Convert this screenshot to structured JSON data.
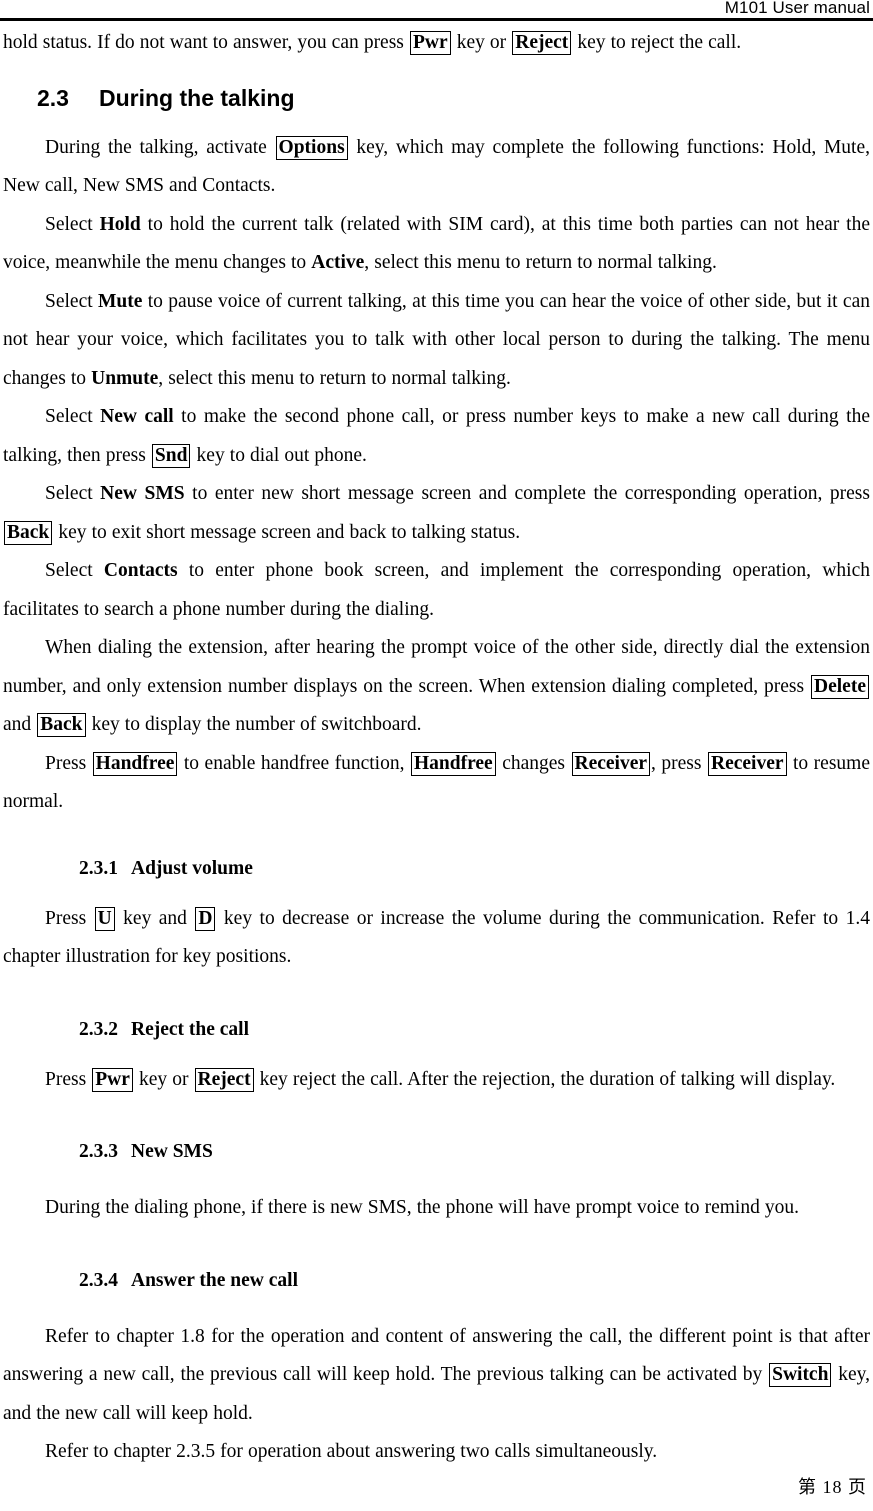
{
  "header": {
    "title": "M101 User manual"
  },
  "footer": {
    "page_label_prefix": "第",
    "page_number": "18",
    "page_label_suffix": "页",
    "full": "第  18  页"
  },
  "content": {
    "carryover_paragraph": {
      "before": "hold status. If do not want to answer, you can press ",
      "key1": "Pwr",
      "mid1": " key or ",
      "key2": "Reject",
      "after": " key to reject the call."
    },
    "section": {
      "number": "2.3",
      "title": "During the talking"
    },
    "p_options": {
      "before": "During the talking, activate ",
      "key1": "Options",
      "after": " key, which may complete the following functions: Hold, Mute, New call, New SMS and Contacts."
    },
    "p_hold": {
      "before": "Select ",
      "bold1": "Hold",
      "mid1": " to hold the current talk (related with SIM card), at this time both parties can not hear the voice, meanwhile the menu changes to ",
      "bold2": "Active",
      "after": ", select this menu to return to normal talking."
    },
    "p_mute": {
      "before": "Select ",
      "bold1": "Mute",
      "mid1": " to pause voice of current talking, at this time you can hear the voice of other side, but it can not hear your voice, which facilitates you to talk with other local person to during the talking. The menu changes to ",
      "bold2": "Unmute",
      "after": ", select this menu to return to normal talking."
    },
    "p_newcall": {
      "before": "Select ",
      "bold1": "New call",
      "mid1": " to make the second phone call, or press number keys to make a new call during the talking, then press ",
      "key1": "Snd",
      "after": " key to dial out phone."
    },
    "p_newsms": {
      "before": "Select ",
      "bold1": "New SMS",
      "mid1": " to enter new short message screen and complete the corresponding operation, press ",
      "key1": "Back",
      "after": " key to exit short message screen and back to talking status."
    },
    "p_contacts": {
      "before": "Select ",
      "bold1": "Contacts",
      "after": " to enter phone book screen, and implement the corresponding operation, which facilitates to search a phone number during the dialing."
    },
    "p_extension": {
      "before": "When dialing the extension, after hearing the prompt voice of the other side, directly dial the extension number, and only extension number displays on the screen. When extension dialing completed, press ",
      "key1": "Delete",
      "mid1": " and ",
      "key2": "Back",
      "after": " key to display the number of switchboard."
    },
    "p_handfree": {
      "before": "Press ",
      "key1": "Handfree",
      "mid1": " to enable handfree function, ",
      "key2": "Handfree",
      "mid2": " changes ",
      "key3": "Receiver",
      "mid3": ", press ",
      "key4": "Receiver",
      "after": " to resume normal."
    },
    "sub_volume": {
      "number": "2.3.1",
      "title": "Adjust volume",
      "body": {
        "before": "Press ",
        "key1": "U",
        "mid1": " key and ",
        "key2": "D",
        "after": " key to decrease or increase the volume during the communication. Refer to 1.4 chapter illustration for key positions."
      }
    },
    "sub_reject": {
      "number": "2.3.2",
      "title": "Reject the call",
      "body": {
        "before": "Press ",
        "key1": "Pwr",
        "mid1": " key or ",
        "key2": "Reject",
        "after": " key reject the call. After the rejection, the duration of talking will display."
      }
    },
    "sub_newsms": {
      "number": "2.3.3",
      "title": "New SMS",
      "body": {
        "text": "During the dialing phone, if there is new SMS, the phone will have prompt voice to remind you."
      }
    },
    "sub_answer": {
      "number": "2.3.4",
      "title": "Answer the new call",
      "body": {
        "before": "Refer to chapter 1.8 for the operation and content of answering the call, the different point is that after answering a new call, the previous call will keep hold. The previous talking can be activated by ",
        "key1": "Switch",
        "after": " key, and the new call will keep hold."
      },
      "body2": {
        "text": "Refer to chapter 2.3.5 for operation about answering two calls simultaneously."
      }
    }
  }
}
